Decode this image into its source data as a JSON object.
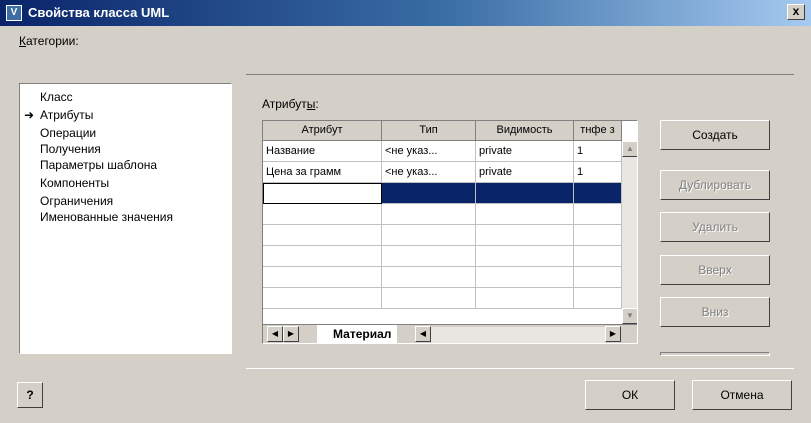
{
  "window": {
    "title": "Свойства класса UML",
    "close_glyph": "x"
  },
  "categories": {
    "label_prefix": "К",
    "label_rest": "атегории:",
    "items": [
      "Класс",
      "Атрибуты",
      "Операции",
      "Получения",
      "Параметры шаблона",
      "Компоненты",
      "Ограничения",
      "Именованные значения"
    ],
    "selected_index": 1,
    "selected_marker": "➜"
  },
  "attributes": {
    "label_prefix": "Атрибут",
    "label_underlined": "ы",
    "label_suffix": ":",
    "columns": [
      "Атрибут",
      "Тип",
      "Видимость",
      "тнфе з"
    ],
    "rows": [
      [
        "Название",
        "<не указ...",
        "private",
        "1"
      ],
      [
        "Цена за грамм",
        "<не указ...",
        "private",
        "1"
      ]
    ],
    "tab_label": "Материал"
  },
  "buttons": {
    "create": "Создать",
    "duplicate": "Дублировать",
    "delete": "Удалить",
    "up": "Вверх",
    "down": "Вниз",
    "ok": "ОК",
    "cancel": "Отмена",
    "help_glyph": "?"
  }
}
